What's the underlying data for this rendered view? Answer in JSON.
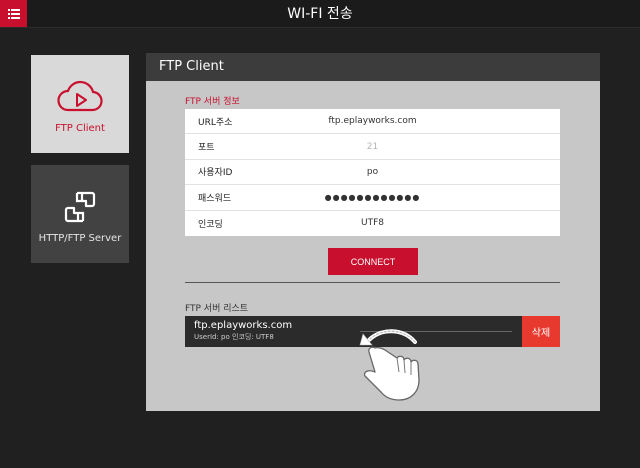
{
  "app": {
    "title": "WI-FI 전송",
    "accent_color": "#c8102e",
    "menu_icon": "hamburger-icon"
  },
  "sidebar": {
    "items": [
      {
        "label": "FTP Client",
        "icon": "cloud-play-icon",
        "active": true
      },
      {
        "label": "HTTP/FTP Server",
        "icon": "link-nodes-icon",
        "active": false
      }
    ]
  },
  "panel": {
    "title": "FTP Client",
    "info_section_label": "FTP 서버 정보",
    "fields": [
      {
        "label": "URL주소",
        "value": "ftp.eplayworks.com"
      },
      {
        "label": "포트",
        "placeholder": "21"
      },
      {
        "label": "사용자ID",
        "value": "po"
      },
      {
        "label": "패스워드",
        "value": "●●●●●●●●●●●●"
      },
      {
        "label": "인코딩",
        "value": "UTF8"
      }
    ],
    "connect_label": "CONNECT",
    "list_section_label": "FTP 서버 리스트",
    "servers": [
      {
        "url": "ftp.eplayworks.com",
        "meta": "UserId: po  인코딩: UTF8",
        "delete_label": "삭제",
        "delete_color": "#e8392f"
      }
    ]
  }
}
